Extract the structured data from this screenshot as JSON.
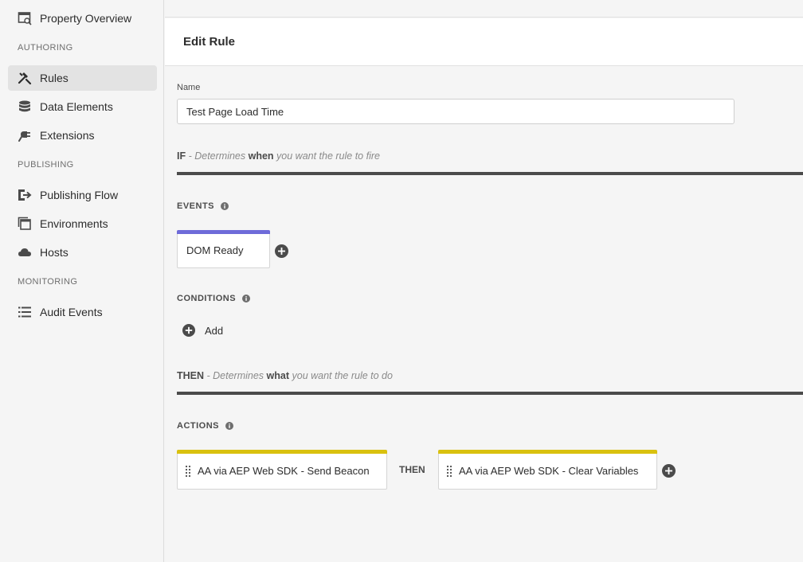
{
  "sidebar": {
    "items": [
      {
        "label": "Property Overview",
        "icon": "property-overview-icon"
      },
      {
        "label": "Rules",
        "icon": "rules-icon"
      },
      {
        "label": "Data Elements",
        "icon": "database-icon"
      },
      {
        "label": "Extensions",
        "icon": "plug-icon"
      },
      {
        "label": "Publishing Flow",
        "icon": "publishing-flow-icon"
      },
      {
        "label": "Environments",
        "icon": "environments-icon"
      },
      {
        "label": "Hosts",
        "icon": "cloud-icon"
      },
      {
        "label": "Audit Events",
        "icon": "list-icon"
      }
    ],
    "sections": {
      "authoring": "AUTHORING",
      "publishing": "PUBLISHING",
      "monitoring": "MONITORING"
    }
  },
  "header": {
    "title": "Edit Rule"
  },
  "form": {
    "name_label": "Name",
    "name_value": "Test Page Load Time"
  },
  "if_section": {
    "keyword": "IF",
    "desc_pre": " - Determines ",
    "desc_em": "when",
    "desc_post": " you want the rule to fire"
  },
  "events": {
    "label": "EVENTS",
    "items": [
      {
        "label": "DOM Ready",
        "color": "#6e6bd9"
      }
    ]
  },
  "conditions": {
    "label": "CONDITIONS",
    "add_label": "Add"
  },
  "then_section": {
    "keyword": "THEN",
    "desc_pre": " - Determines ",
    "desc_em": "what",
    "desc_post": " you want the rule to do"
  },
  "actions": {
    "label": "ACTIONS",
    "items": [
      {
        "label": "AA via AEP Web SDK - Send Beacon",
        "color": "#d9c10f"
      },
      {
        "label": "AA via AEP Web SDK - Clear Variables",
        "color": "#d9c10f"
      }
    ],
    "separator": "THEN"
  }
}
